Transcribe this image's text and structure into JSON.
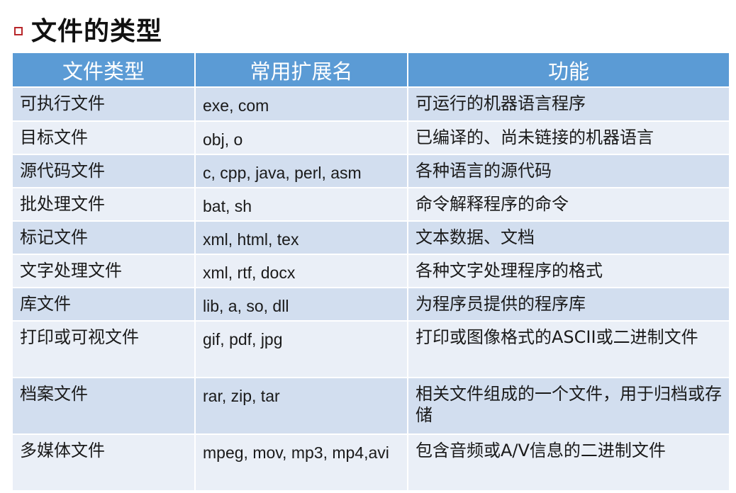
{
  "heading": "文件的类型",
  "table": {
    "headers": [
      "文件类型",
      "常用扩展名",
      "功能"
    ],
    "rows": [
      {
        "type": "可执行文件",
        "ext": "exe, com",
        "func": "可运行的机器语言程序"
      },
      {
        "type": "目标文件",
        "ext": "obj, o",
        "func": "已编译的、尚未链接的机器语言"
      },
      {
        "type": "源代码文件",
        "ext": "c, cpp, java, perl, asm",
        "func": "各种语言的源代码"
      },
      {
        "type": "批处理文件",
        "ext": "bat, sh",
        "func": "命令解释程序的命令"
      },
      {
        "type": "标记文件",
        "ext": "xml, html, tex",
        "func": "文本数据、文档"
      },
      {
        "type": "文字处理文件",
        "ext": "xml, rtf, docx",
        "func": "各种文字处理程序的格式"
      },
      {
        "type": "库文件",
        "ext": "lib, a, so, dll",
        "func": "为程序员提供的程序库"
      },
      {
        "type": "打印或可视文件",
        "ext": "gif, pdf, jpg",
        "func": "打印或图像格式的ASCII或二进制文件"
      },
      {
        "type": "档案文件",
        "ext": "rar, zip, tar",
        "func": "相关文件组成的一个文件，用于归档或存储"
      },
      {
        "type": "多媒体文件",
        "ext": "mpeg, mov, mp3, mp4,avi",
        "func": "包含音频或A/V信息的二进制文件"
      }
    ]
  },
  "colors": {
    "header_bg": "#5b9bd5",
    "row_odd_bg": "#d2deef",
    "row_even_bg": "#eaeff7",
    "bullet_border": "#b8262a"
  }
}
